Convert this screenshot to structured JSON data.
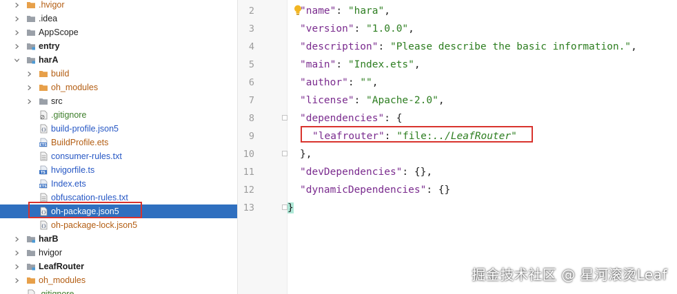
{
  "tree": {
    "items": [
      {
        "label": ".hvigor",
        "style": "orange",
        "icon": "folder-orange-icon",
        "chevron": "right"
      },
      {
        "label": ".idea",
        "style": "normal",
        "icon": "folder-icon",
        "chevron": "right"
      },
      {
        "label": "AppScope",
        "style": "normal",
        "icon": "folder-icon",
        "chevron": "right"
      },
      {
        "label": "entry",
        "style": "bold",
        "icon": "module-folder-icon",
        "chevron": "right"
      },
      {
        "label": "harA",
        "style": "bold",
        "icon": "module-folder-icon",
        "chevron": "down"
      },
      {
        "label": "build",
        "style": "orange",
        "icon": "folder-orange-icon",
        "chevron": "right"
      },
      {
        "label": "oh_modules",
        "style": "orange",
        "icon": "folder-orange-icon",
        "chevron": "right"
      },
      {
        "label": "src",
        "style": "normal",
        "icon": "folder-icon",
        "chevron": "right"
      },
      {
        "label": ".gitignore",
        "style": "green",
        "icon": "gitignore-file-icon",
        "chevron": "none"
      },
      {
        "label": "build-profile.json5",
        "style": "blue",
        "icon": "json5-file-icon",
        "chevron": "none"
      },
      {
        "label": "BuildProfile.ets",
        "style": "orange",
        "icon": "ets-file-icon",
        "chevron": "none"
      },
      {
        "label": "consumer-rules.txt",
        "style": "blue",
        "icon": "text-file-icon",
        "chevron": "none"
      },
      {
        "label": "hvigorfile.ts",
        "style": "blue",
        "icon": "ts-file-icon",
        "chevron": "none"
      },
      {
        "label": "Index.ets",
        "style": "blue",
        "icon": "ets-file-icon",
        "chevron": "none"
      },
      {
        "label": "obfuscation-rules.txt",
        "style": "blue",
        "icon": "text-file-icon",
        "chevron": "none"
      },
      {
        "label": "oh-package.json5",
        "style": "selected",
        "icon": "json5-file-icon",
        "chevron": "none"
      },
      {
        "label": "oh-package-lock.json5",
        "style": "orange",
        "icon": "json5-file-icon",
        "chevron": "none"
      },
      {
        "label": "harB",
        "style": "bold",
        "icon": "module-folder-icon",
        "chevron": "right"
      },
      {
        "label": "hvigor",
        "style": "normal",
        "icon": "folder-icon",
        "chevron": "right"
      },
      {
        "label": "LeafRouter",
        "style": "bold",
        "icon": "module-folder-icon",
        "chevron": "right"
      },
      {
        "label": "oh_modules",
        "style": "orange",
        "icon": "folder-orange-icon",
        "chevron": "right"
      },
      {
        "label": ".gitignore",
        "style": "green",
        "icon": "gitignore-file-icon",
        "chevron": "none"
      }
    ]
  },
  "editor": {
    "line_numbers": [
      "2",
      "3",
      "4",
      "5",
      "6",
      "7",
      "8",
      "9",
      "10",
      "11",
      "12",
      "13"
    ],
    "lines": {
      "l2": {
        "k": "\"name\"",
        "p": ": ",
        "v": "\"hara\"",
        "e": ","
      },
      "l3": {
        "k": "\"version\"",
        "p": ": ",
        "v": "\"1.0.0\"",
        "e": ","
      },
      "l4": {
        "k": "\"description\"",
        "p": ": ",
        "v": "\"Please describe the basic information.\"",
        "e": ","
      },
      "l5": {
        "k": "\"main\"",
        "p": ": ",
        "v": "\"Index.ets\"",
        "e": ","
      },
      "l6": {
        "k": "\"author\"",
        "p": ": ",
        "v": "\"\"",
        "e": ","
      },
      "l7": {
        "k": "\"license\"",
        "p": ": ",
        "v": "\"Apache-2.0\"",
        "e": ","
      },
      "l8": {
        "k": "\"dependencies\"",
        "p": ": ",
        "v": "{",
        "e": ""
      },
      "l9": {
        "k": "\"leafrouter\"",
        "p": ": ",
        "v1": "\"file:",
        "v2": "../LeafRouter",
        "v3": "\"",
        "e": ""
      },
      "l10": {
        "text": "},"
      },
      "l11": {
        "k": "\"devDependencies\"",
        "p": ": ",
        "v": "{}",
        "e": ","
      },
      "l12": {
        "k": "\"dynamicDependencies\"",
        "p": ": ",
        "v": "{}",
        "e": ""
      },
      "l13": {
        "text": "}"
      }
    }
  },
  "watermark": "掘金技术社区 @ 星河滚烫Leaf",
  "colors": {
    "selection": "#2f6fbf",
    "highlight_box": "#d8322c",
    "string": "#2c7d1f",
    "key": "#7a2b8e"
  }
}
